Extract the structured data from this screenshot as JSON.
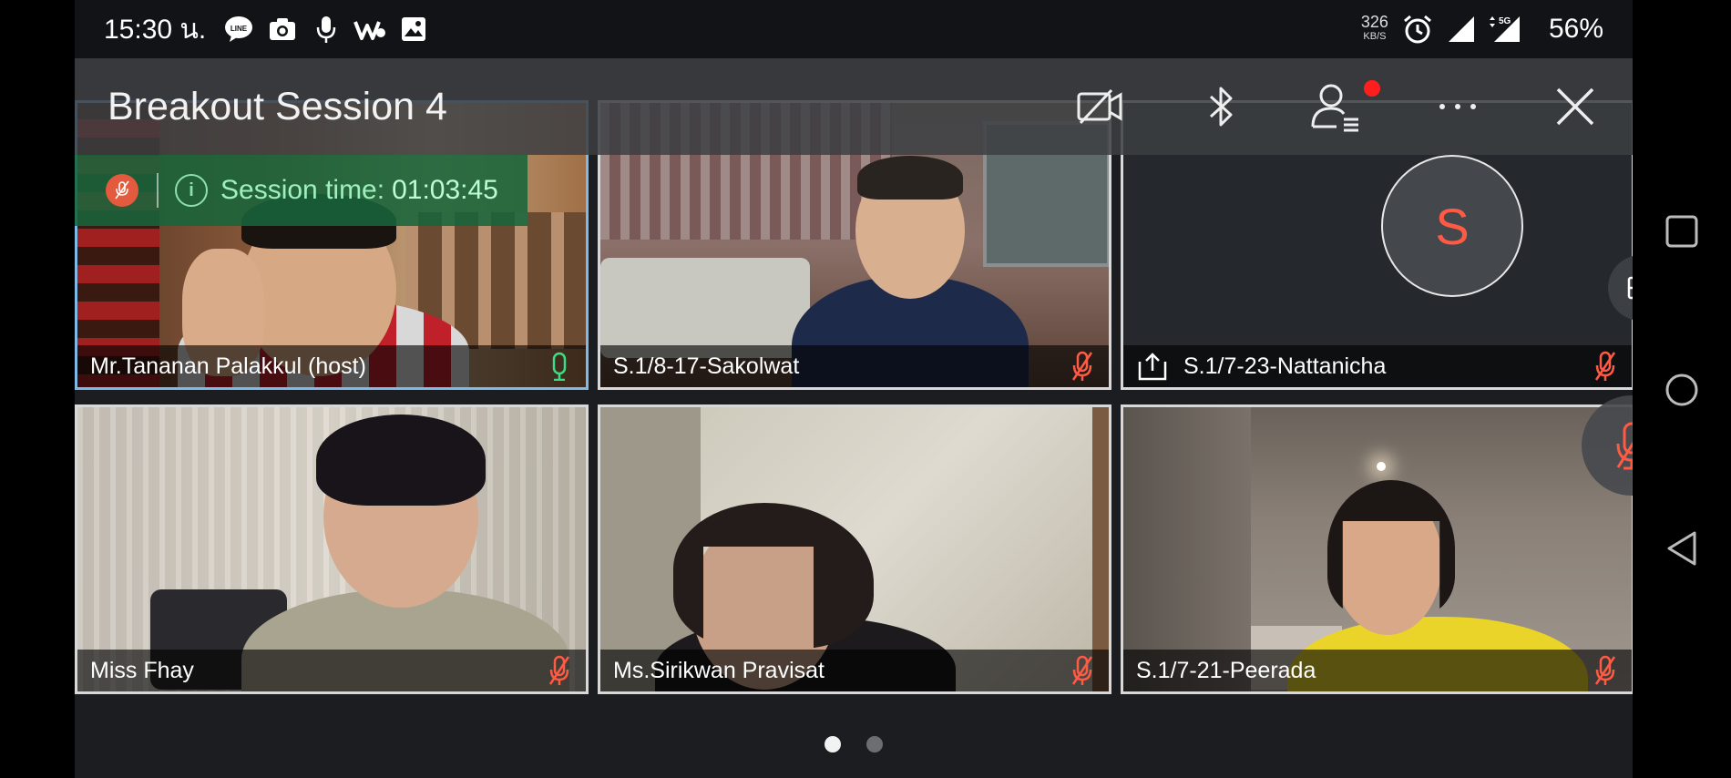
{
  "status_bar": {
    "time": "15:30 น.",
    "net_speed_value": "326",
    "net_speed_unit": "KB/S",
    "network": "5G",
    "battery": "56%"
  },
  "top_bar": {
    "title": "Breakout Session 4",
    "icons": [
      "camera-off-icon",
      "bluetooth-icon",
      "participants-icon",
      "more-icon",
      "close-icon"
    ]
  },
  "timer": {
    "label": "Session time:",
    "value": "01:03:45"
  },
  "participants": [
    {
      "name": "Mr.Tananan Palakkul (host)",
      "mic": "on",
      "active": true
    },
    {
      "name": "S.1/8-17-Sakolwat",
      "mic": "muted"
    },
    {
      "name": "S.1/7-23-Nattanicha",
      "mic": "muted",
      "avatar_letter": "S",
      "sharing": true
    },
    {
      "name": "Miss Fhay",
      "mic": "muted"
    },
    {
      "name": "Ms.Sirikwan Pravisat",
      "mic": "muted"
    },
    {
      "name": "S.1/7-21-Peerada",
      "mic": "muted"
    }
  ],
  "pager": {
    "pages": 2,
    "current": 1
  },
  "colors": {
    "accent_green": "#18643a",
    "muted_red": "#ff5a44",
    "mic_on_green": "#3ddc84",
    "active_border": "#7fb9e8"
  }
}
